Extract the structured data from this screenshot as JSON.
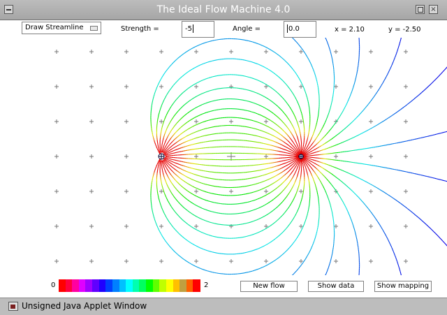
{
  "window": {
    "title": "The Ideal Flow Machine 4.0",
    "close_glyph": "×"
  },
  "toolbar": {
    "mode_select": "Draw Streamline",
    "strength_label": "Strength =",
    "strength_value": "-5",
    "angle_label": "Angle =",
    "angle_value": "0.0",
    "x_readout": "x =  2.10",
    "y_readout": "y = -2.50"
  },
  "colorbar": {
    "min_label": "0",
    "max_label": "2",
    "colors": [
      "#ff0000",
      "#ff0040",
      "#ff00a0",
      "#e000ff",
      "#a000ff",
      "#6000ff",
      "#2000ff",
      "#0040ff",
      "#0080ff",
      "#00c0ff",
      "#00ffff",
      "#00ffb0",
      "#00ff60",
      "#00ff00",
      "#60ff00",
      "#c0ff00",
      "#ffff00",
      "#ffc000",
      "#c0a040",
      "#ff6000",
      "#ff0000"
    ]
  },
  "buttons": {
    "new_flow": "New flow",
    "show_data": "Show data",
    "show_mapping": "Show mapping"
  },
  "status": {
    "text": "Unsigned Java Applet Window"
  },
  "flow": {
    "source_x": 2.0,
    "sink_x": -2.0,
    "grid_x": [
      -5,
      -4,
      -3,
      -2,
      -1,
      0,
      1,
      2,
      3,
      4,
      5
    ],
    "grid_y": [
      3,
      2,
      1,
      0,
      -1,
      -2,
      -3
    ]
  }
}
